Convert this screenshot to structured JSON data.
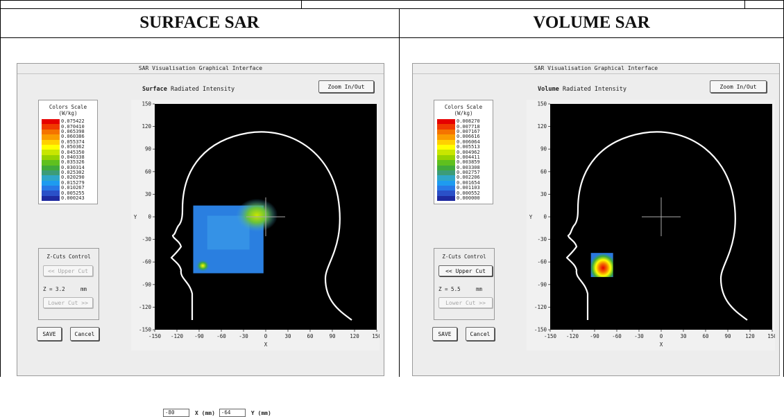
{
  "headers": {
    "left": "SURFACE SAR",
    "right": "VOLUME SAR"
  },
  "panels": [
    {
      "window_title": "SAR Visualisation Graphical Interface",
      "mode": "Surface",
      "subtitle": "Radiated Intensity",
      "zoom_label": "Zoom In/Out",
      "scale": {
        "title_line1": "Colors Scale",
        "title_line2": "(W/kg)",
        "values": [
          "0.075422",
          "0.070410",
          "0.065398",
          "0.060386",
          "0.055374",
          "0.050362",
          "0.045350",
          "0.040338",
          "0.035326",
          "0.030314",
          "0.025302",
          "0.020290",
          "0.015279",
          "0.010267",
          "0.005255",
          "0.000243"
        ]
      },
      "zcuts": {
        "title": "Z-Cuts Control",
        "upper_label": "<< Upper Cut",
        "upper_enabled": false,
        "z_label": "Z = 3.2",
        "z_unit": "mm",
        "lower_label": "Lower Cut >>",
        "lower_enabled": false
      },
      "save_label": "SAVE",
      "cancel_label": "Cancel",
      "x_input": "-80",
      "x_label": "X (mm)",
      "y_input": "-64",
      "y_label": "Y (mm)",
      "xlabel": "X",
      "ylabel": "Y"
    },
    {
      "window_title": "SAR Visualisation Graphical Interface",
      "mode": "Volume",
      "subtitle": "Radiated Intensity",
      "zoom_label": "Zoom In/Out",
      "scale": {
        "title_line1": "Colors Scale",
        "title_line2": "(W/kg)",
        "values": [
          "0.008270",
          "0.007718",
          "0.007167",
          "0.006616",
          "0.006064",
          "0.005513",
          "0.004962",
          "0.004411",
          "0.003859",
          "0.003308",
          "0.002757",
          "0.002206",
          "0.001654",
          "0.001103",
          "0.000552",
          "0.000000"
        ]
      },
      "zcuts": {
        "title": "Z-Cuts Control",
        "upper_label": "<< Upper Cut",
        "upper_enabled": true,
        "z_label": "Z = 5.5",
        "z_unit": "mm",
        "lower_label": "Lower Cut >>",
        "lower_enabled": false
      },
      "save_label": "SAVE",
      "cancel_label": "Cancel",
      "xlabel": "X",
      "ylabel": "Y"
    }
  ],
  "scale_colors": [
    "#e60000",
    "#f03a00",
    "#f57300",
    "#fa9d00",
    "#ffd000",
    "#ffff00",
    "#c8e600",
    "#96d200",
    "#5fc01e",
    "#3faa3c",
    "#3c9c78",
    "#2fa6c8",
    "#1e9bf0",
    "#2878e6",
    "#2a50c8",
    "#1e2aa0"
  ],
  "chart_data": [
    {
      "type": "heatmap",
      "xlabel": "X",
      "ylabel": "Y",
      "xlim": [
        -150,
        150
      ],
      "ylim": [
        -150,
        150
      ],
      "x_ticks": [
        -150,
        -120,
        -90,
        -60,
        -30,
        0,
        30,
        60,
        90,
        120,
        150
      ],
      "y_ticks": [
        150,
        120,
        90,
        60,
        30,
        0,
        -30,
        -60,
        -90,
        -120,
        -150
      ],
      "sar_region": {
        "x_min": -98,
        "x_max": -3,
        "y_min": -75,
        "y_max": 15
      },
      "hotspots": [
        {
          "x": -12,
          "y": 2,
          "level": "green"
        },
        {
          "x": -85,
          "y": -65,
          "level": "green-yellow"
        }
      ],
      "crosshair": {
        "x": 0,
        "y": 0
      }
    },
    {
      "type": "heatmap",
      "xlabel": "X",
      "ylabel": "Y",
      "xlim": [
        -150,
        150
      ],
      "ylim": [
        -150,
        150
      ],
      "x_ticks": [
        -150,
        -120,
        -90,
        -60,
        -30,
        0,
        30,
        60,
        90,
        120,
        150
      ],
      "y_ticks": [
        150,
        120,
        90,
        60,
        30,
        0,
        -30,
        -60,
        -90,
        -120,
        -150
      ],
      "sar_region": {
        "x_min": -95,
        "x_max": -65,
        "y_min": -80,
        "y_max": -48
      },
      "hotspots": [
        {
          "x": -80,
          "y": -68,
          "level": "red"
        }
      ],
      "crosshair": {
        "x": 0,
        "y": 0
      }
    }
  ]
}
